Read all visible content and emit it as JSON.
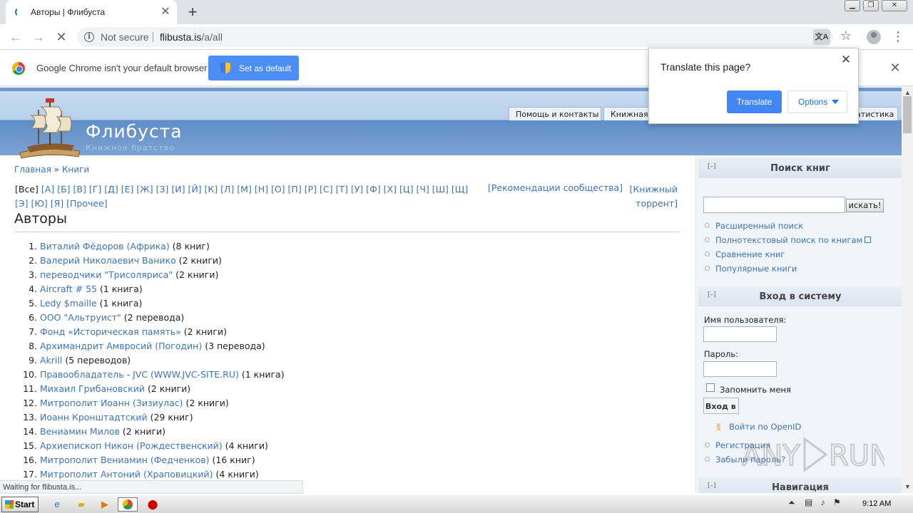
{
  "browser": {
    "tab_title": "Авторы | Флибуста",
    "omnibox": {
      "security": "Not secure",
      "host": "flibusta.is",
      "path": "/a/all"
    },
    "icons": [
      "back-arrow-icon",
      "forward-arrow-icon",
      "stop-reload-icon",
      "info-icon",
      "translate-icon",
      "star-icon",
      "profile-icon",
      "menu-icon"
    ]
  },
  "infobar": {
    "message": "Google Chrome isn't your default browser",
    "button": "Set as default"
  },
  "translate_popup": {
    "title": "Translate this page?",
    "translate_button": "Translate",
    "options_button": "Options"
  },
  "site": {
    "name": "Флибуста",
    "slogan": "Книжное братство",
    "header_tabs": [
      "Помощь и контакты",
      "Книжная",
      "Статистика"
    ]
  },
  "breadcrumb": {
    "home": "Главная",
    "sep": "»",
    "current": "Книги"
  },
  "letters": {
    "all": "[Все]",
    "items": [
      "[А]",
      "[Б]",
      "[В]",
      "[Г]",
      "[Д]",
      "[Е]",
      "[Ж]",
      "[З]",
      "[И]",
      "[Й]",
      "[К]",
      "[Л]",
      "[М]",
      "[Н]",
      "[О]",
      "[П]",
      "[Р]",
      "[С]",
      "[Т]",
      "[У]",
      "[Ф]",
      "[Х]",
      "[Ц]",
      "[Ч]",
      "[Ш]",
      "[Щ]",
      "[Э]",
      "[Ю]",
      "[Я]",
      "[Прочее]"
    ],
    "recommendations": "[Рекомендации сообщества]",
    "torrent": "[Книжный торрент]"
  },
  "page_title": "Авторы",
  "authors": [
    {
      "num": "1.",
      "name": "Виталий Фёдоров (Африка)",
      "count": "(8 книг)"
    },
    {
      "num": "2.",
      "name": "Валерий Николаевич Ванико",
      "count": "(2 книги)"
    },
    {
      "num": "3.",
      "name": "переводчики \"Трисоляриса\"",
      "count": "(2 книги)"
    },
    {
      "num": "4.",
      "name": "Aircraft # 55",
      "count": "(1 книга)"
    },
    {
      "num": "5.",
      "name": "Ledy $maille",
      "count": "(1 книга)"
    },
    {
      "num": "6.",
      "name": "ООО \"Альтруист\"",
      "count": "(2 перевода)"
    },
    {
      "num": "7.",
      "name": "Фонд «Историческая память»",
      "count": "(2 книги)"
    },
    {
      "num": "8.",
      "name": "Архимандрит Амвросий (Погодин)",
      "count": "(3 перевода)"
    },
    {
      "num": "9.",
      "name": "Akrill",
      "count": "(5 переводов)"
    },
    {
      "num": "10.",
      "name": "Правообладатель - JVC (WWW.JVC-SITE.RU)",
      "count": "(1 книга)"
    },
    {
      "num": "11.",
      "name": "Михаил Грибановский",
      "count": "(2 книги)"
    },
    {
      "num": "12.",
      "name": "Митрополит Иоанн (Зизиулас)",
      "count": "(2 книги)"
    },
    {
      "num": "13.",
      "name": "Иоанн Кронштадтский",
      "count": "(29 книг)"
    },
    {
      "num": "14.",
      "name": "Вениамин Милов",
      "count": "(2 книги)"
    },
    {
      "num": "15.",
      "name": "Архиепископ Никон (Рождественский)",
      "count": "(4 книги)"
    },
    {
      "num": "16.",
      "name": "Митрополит Вениамин (Федченков)",
      "count": "(16 книг)"
    },
    {
      "num": "17.",
      "name": "Митрополит Антоний (Храповицкий)",
      "count": "(4 книги)"
    }
  ],
  "sidebar": {
    "search": {
      "title": "Поиск книг",
      "collapse": "[–]",
      "button": "искать!",
      "links": [
        "Расширенный поиск",
        "Полнотекстовый поиск по книгам",
        "Сравнение книг",
        "Популярные книги"
      ]
    },
    "login": {
      "title": "Вход в систему",
      "collapse": "[–]",
      "username_label": "Имя пользователя:",
      "password_label": "Пароль:",
      "remember": "Запомнить меня",
      "button": "Вход в с",
      "openid": "Войти по OpenID",
      "links": [
        "Регистрация",
        "Забыли пароль?"
      ]
    },
    "nav": {
      "title": "Навигация",
      "collapse": "[–]"
    }
  },
  "status_bubble": "Waiting for flibusta.is...",
  "taskbar": {
    "start": "Start",
    "time": "9:12 AM"
  },
  "colors": {
    "link": "#3b73b9",
    "chrome_blue": "#4285f4",
    "header_blue": "#6f9bd4"
  }
}
